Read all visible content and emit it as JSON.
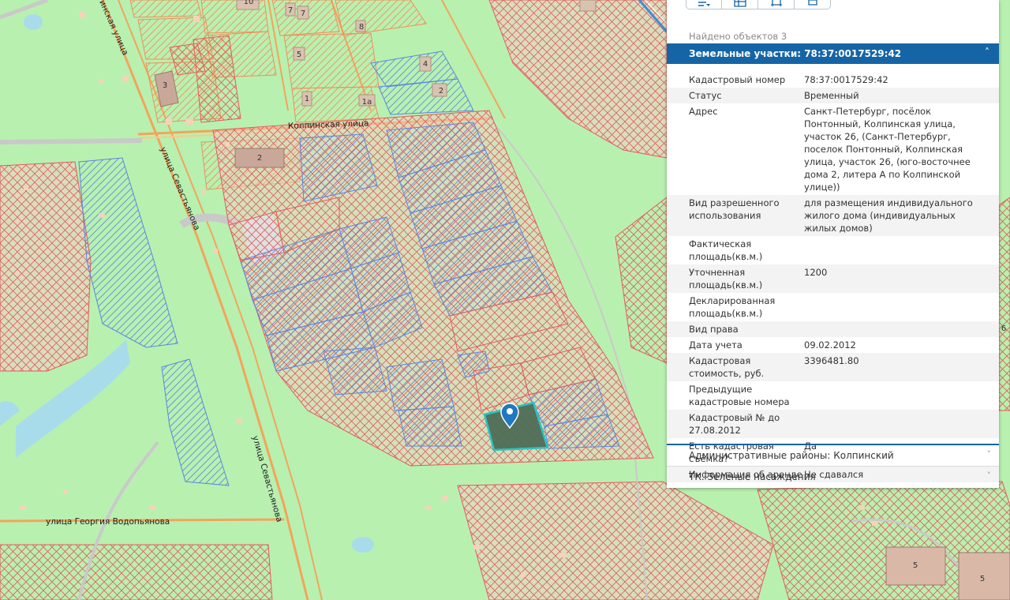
{
  "toolbar": {
    "buttons": [
      {
        "name": "list-filter-icon"
      },
      {
        "name": "table-view-icon"
      },
      {
        "name": "frame-icon"
      },
      {
        "name": "print-icon"
      }
    ]
  },
  "panel": {
    "found_text": "Найдено объектов 3",
    "section_title": "Земельные участки: 78:37:0017529:42",
    "rows": [
      {
        "key": "Кадастровый номер",
        "value": "78:37:0017529:42"
      },
      {
        "key": "Статус",
        "value": "Временный"
      },
      {
        "key": "Адрес",
        "value": "Санкт-Петербург, посёлок Понтонный, Колпинская улица, участок 26, (Санкт-Петербург, поселок Понтонный, Колпинская улица, участок 26, (юго-восточнее дома 2, литера А по Колпинской улице))"
      },
      {
        "key": "Вид разрешенного использования",
        "value": "для размещения индивидуального жилого дома (индивидуальных жилых домов)"
      },
      {
        "key": "Фактическая площадь(кв.м.)",
        "value": ""
      },
      {
        "key": "Уточненная площадь(кв.м.)",
        "value": "1200"
      },
      {
        "key": "Декларированная площадь(кв.м.)",
        "value": ""
      },
      {
        "key": "Вид права",
        "value": ""
      },
      {
        "key": "Дата учета",
        "value": "09.02.2012"
      },
      {
        "key": "Кадастровая стоимость, руб.",
        "value": "3396481.80"
      },
      {
        "key": "Предыдущие кадастровые номера",
        "value": ""
      },
      {
        "key": "Кадастровый № до 27.08.2012",
        "value": ""
      },
      {
        "key": "Есть кадастровая съёмка?",
        "value": "Да"
      },
      {
        "key": "Информация об аренде",
        "value": "Не сдавался"
      }
    ],
    "collapsed_sections": [
      {
        "title": "Административные районы: Колпинский"
      },
      {
        "title": "ТК. Зелёные насаждения"
      }
    ]
  },
  "map": {
    "street_labels": [
      {
        "id": "kolpinskaya",
        "text": "Колпинская улица"
      },
      {
        "id": "sevastyanova-1",
        "text": "улица Севастьянова"
      },
      {
        "id": "sevastyanova-2",
        "text": "улица Севастьянова"
      },
      {
        "id": "vodopyanova",
        "text": "улица Георгия Водопьянова"
      },
      {
        "id": "kolpinskaya-top",
        "text": "инская улица"
      }
    ],
    "building_numbers": [
      "10",
      "7",
      "7",
      "8",
      "5",
      "3",
      "4",
      "2",
      "1",
      "1а",
      "2",
      "5",
      "5",
      "6"
    ],
    "colors": {
      "background": "#b8f0b0",
      "road": "#f2a55a",
      "red_hatch": "#e35b5b",
      "blue_hatch": "#5a86e0",
      "selected_fill": "#4f6e57",
      "selected_border": "#20c5c5",
      "marker": "#1f78c1"
    }
  }
}
